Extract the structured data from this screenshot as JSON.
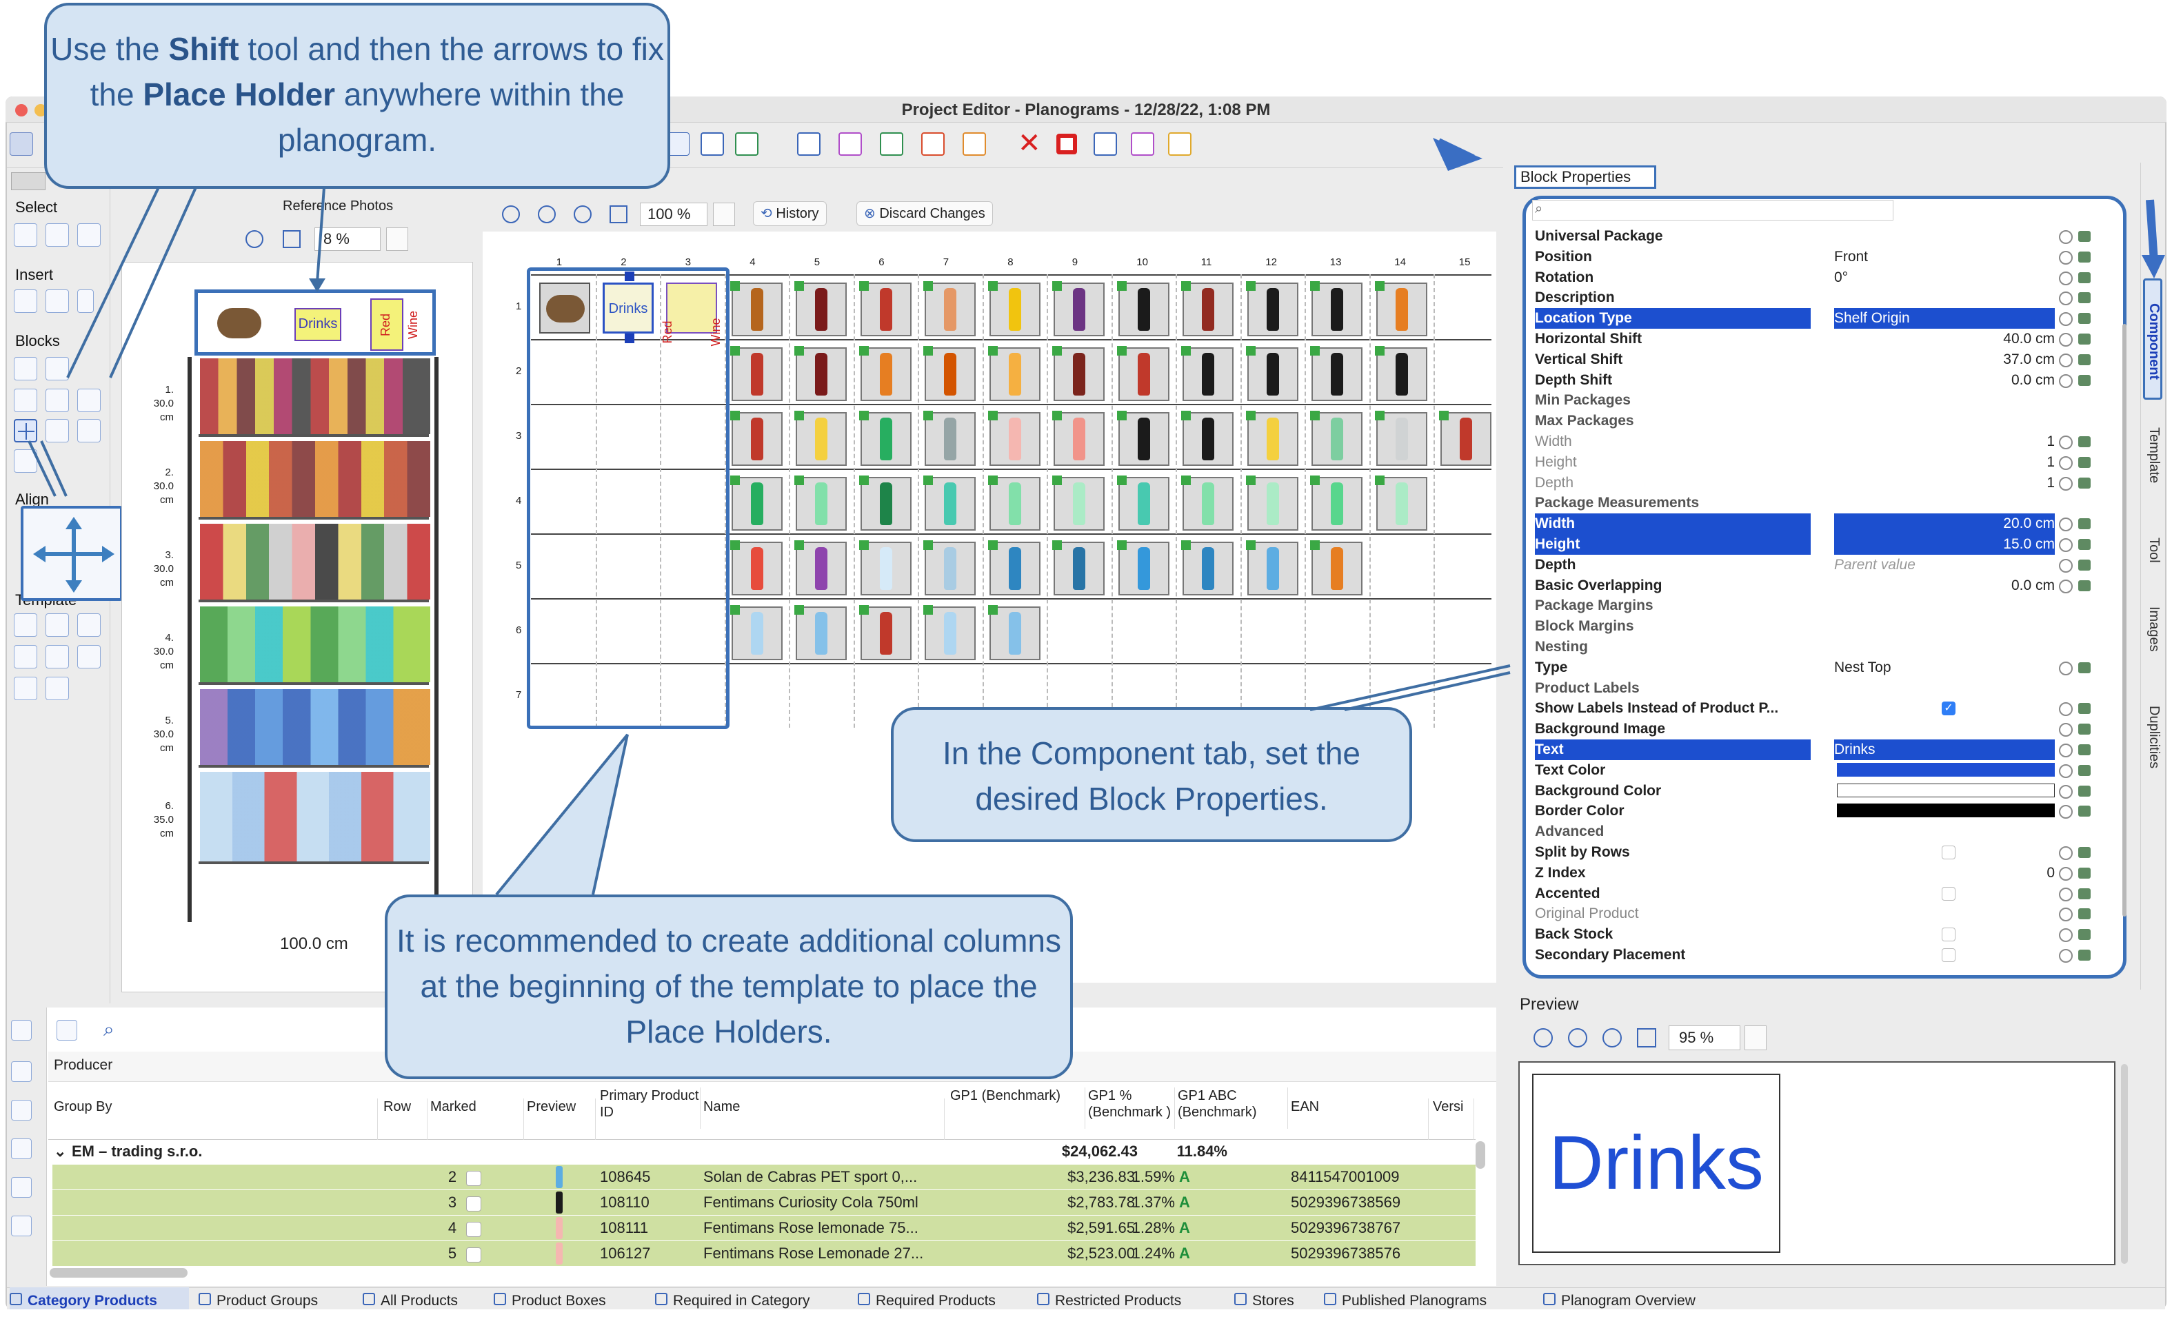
{
  "window": {
    "title": "Project Editor - Planograms - 12/28/22, 1:08 PM"
  },
  "left_palette": {
    "select_label": "Select",
    "insert_label": "Insert",
    "blocks_label": "Blocks",
    "align_label": "Align",
    "template_label": "Template"
  },
  "thumbnail_panel": {
    "tab_label": "Reference Photos",
    "zoom_value": "8 %",
    "width_label": "100.0 cm",
    "shelves": [
      {
        "num": "1.",
        "height": "30.0 cm"
      },
      {
        "num": "2.",
        "height": "30.0 cm"
      },
      {
        "num": "3.",
        "height": "30.0 cm"
      },
      {
        "num": "4.",
        "height": "30.0 cm"
      },
      {
        "num": "5.",
        "height": "30.0 cm"
      },
      {
        "num": "6.",
        "height": "35.0 cm"
      }
    ],
    "placeholder_labels": {
      "drinks": "Drinks",
      "red_wine": "Red Wine"
    }
  },
  "editor": {
    "zoom_value": "100 %",
    "history_label": "History",
    "discard_label": "Discard Changes",
    "column_numbers": [
      "1",
      "2",
      "3",
      "4",
      "5",
      "6",
      "7",
      "8",
      "9",
      "10",
      "11",
      "12",
      "13",
      "14",
      "15"
    ],
    "row_numbers": [
      "1",
      "2",
      "3",
      "4",
      "5",
      "6",
      "7"
    ],
    "placeholder_labels": {
      "drinks": "Drinks",
      "red_wine": "Red Wine"
    }
  },
  "block_properties": {
    "header": "Block Properties",
    "rows": [
      {
        "name": "Universal Package",
        "value": ""
      },
      {
        "name": "Position",
        "value": "Front"
      },
      {
        "name": "Rotation",
        "value": "0°"
      },
      {
        "name": "Description",
        "value": ""
      },
      {
        "name": "Location Type",
        "value": "Shelf Origin"
      },
      {
        "name": "Horizontal Shift",
        "value": "40.0 cm"
      },
      {
        "name": "Vertical Shift",
        "value": "37.0 cm"
      },
      {
        "name": "Depth Shift",
        "value": "0.0 cm"
      },
      {
        "name": "Min Packages",
        "value": ""
      },
      {
        "name": "Max Packages",
        "value": ""
      },
      {
        "name": "Width",
        "value": "1"
      },
      {
        "name": "Height",
        "value": "1"
      },
      {
        "name": "Depth",
        "value": "1"
      },
      {
        "name": "Package Measurements",
        "value": ""
      },
      {
        "name": "Width",
        "value": "20.0 cm"
      },
      {
        "name": "Height",
        "value": "15.0 cm"
      },
      {
        "name": "Depth",
        "value": "Parent value"
      },
      {
        "name": "Basic Overlapping",
        "value": "0.0 cm"
      },
      {
        "name": "Package Margins",
        "value": ""
      },
      {
        "name": "Block Margins",
        "value": ""
      },
      {
        "name": "Nesting",
        "value": ""
      },
      {
        "name": "Type",
        "value": "Nest Top"
      },
      {
        "name": "Product Labels",
        "value": ""
      },
      {
        "name": "Show Labels Instead of Product P...",
        "value": ""
      },
      {
        "name": "Background Image",
        "value": ""
      },
      {
        "name": "Text",
        "value": "Drinks"
      },
      {
        "name": "Text Color",
        "value": ""
      },
      {
        "name": "Background Color",
        "value": ""
      },
      {
        "name": "Border Color",
        "value": ""
      },
      {
        "name": "Advanced",
        "value": ""
      },
      {
        "name": "Split by Rows",
        "value": ""
      },
      {
        "name": "Z Index",
        "value": "0"
      },
      {
        "name": "Accented",
        "value": ""
      },
      {
        "name": "Original Product",
        "value": ""
      },
      {
        "name": "Back Stock",
        "value": ""
      },
      {
        "name": "Secondary Placement",
        "value": ""
      }
    ],
    "colors": {
      "text_color": "#1f4fd4",
      "background_color": "#ffffff",
      "border_color": "#000000",
      "selection": "#1c4fcf"
    }
  },
  "side_tabs": [
    "Component",
    "Template",
    "Tool",
    "Images",
    "Duplicities"
  ],
  "preview": {
    "label": "Preview",
    "zoom_value": "95 %",
    "text": "Drinks"
  },
  "table": {
    "sort_label": "Producer",
    "columns": [
      "Group By",
      "Row",
      "Marked",
      "Preview",
      "Primary Product ID",
      "Name",
      "GP1 (Benchmark)",
      "GP1 % (Benchmark )",
      "GP1 ABC (Benchmark)",
      "EAN",
      "Versi"
    ],
    "group": {
      "name": "EM – trading s.r.o.",
      "gp1": "$24,062.43",
      "gp1_pct": "11.84%"
    },
    "rows": [
      {
        "row": "2",
        "id": "108645",
        "name": "Solan de Cabras PET sport 0,...",
        "gp1": "$3,236.83",
        "pct": "1.59%",
        "abc": "A",
        "ean": "8411547001009"
      },
      {
        "row": "3",
        "id": "108110",
        "name": "Fentimans Curiosity Cola 750ml",
        "gp1": "$2,783.78",
        "pct": "1.37%",
        "abc": "A",
        "ean": "5029396738569"
      },
      {
        "row": "4",
        "id": "108111",
        "name": "Fentimans Rose lemonade 75...",
        "gp1": "$2,591.65",
        "pct": "1.28%",
        "abc": "A",
        "ean": "5029396738767"
      },
      {
        "row": "5",
        "id": "106127",
        "name": "Fentimans Rose Lemonade 27...",
        "gp1": "$2,523.00",
        "pct": "1.24%",
        "abc": "A",
        "ean": "5029396738576"
      }
    ]
  },
  "bottom_tabs": [
    "Category Products",
    "Product Groups",
    "All Products",
    "Product Boxes",
    "Required in Category",
    "Required Products",
    "Restricted Products",
    "Stores",
    "Published Planograms",
    "Planogram Overview"
  ],
  "callouts": {
    "shift_tool": "Use the Shift tool and then the arrows to fix the Place Holder anywhere within the planogram.",
    "shift_tool_parts": [
      "Use the ",
      "Shift",
      " tool and then the arrows to fix the ",
      "Place Holder",
      " anywhere within the planogram."
    ],
    "component_tab": "In the Component tab, set the desired Block Properties.",
    "columns_tip": "It is recommended to create additional columns at the beginning of the template to place the Place Holders."
  }
}
